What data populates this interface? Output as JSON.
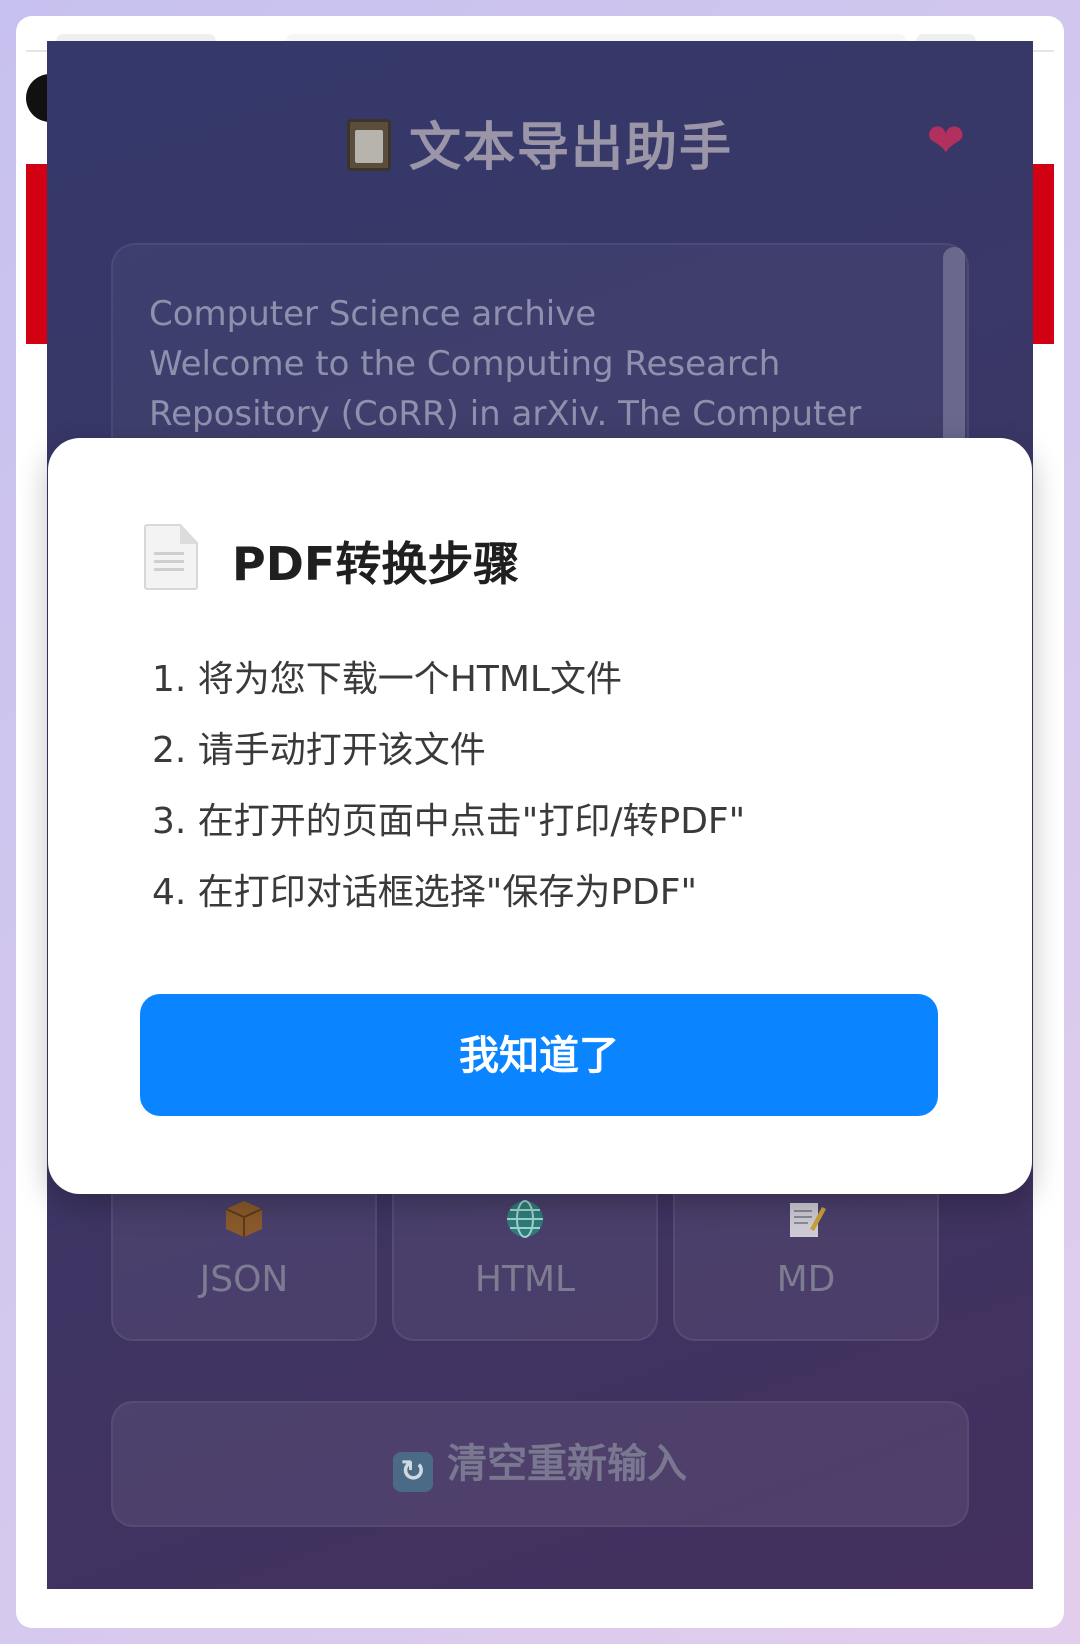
{
  "panel": {
    "title": "文本导出助手",
    "title_icon": "clipboard-icon",
    "corner_icon": "sparkling-heart-icon",
    "text_area_lines": [
      "Computer Science archive",
      "Welcome to the Computing Research",
      "Repository (CoRR) in arXiv. The Computer"
    ],
    "formats": [
      {
        "label": "JSON",
        "icon": "package-icon"
      },
      {
        "label": "HTML",
        "icon": "globe-icon"
      },
      {
        "label": "MD",
        "icon": "memo-icon"
      }
    ],
    "clear_button_label": "清空重新输入",
    "clear_button_icon": "refresh-icon"
  },
  "modal": {
    "icon": "page-icon",
    "title": "PDF转换步骤",
    "steps": [
      "1. 将为您下载一个HTML文件",
      "2. 请手动打开该文件",
      "3. 在打开的页面中点击\"打印/转PDF\"",
      "4. 在打印对话框选择\"保存为PDF\""
    ],
    "confirm_label": "我知道了"
  },
  "colors": {
    "accent": "#0a84ff",
    "panel_top": "#34386a",
    "panel_bottom": "#43305e",
    "background_banner": "#d10012"
  }
}
